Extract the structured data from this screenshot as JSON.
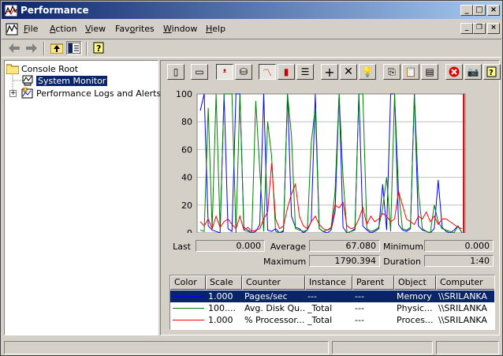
{
  "window": {
    "title": "Performance",
    "controls": [
      "minimize",
      "maximize",
      "close"
    ]
  },
  "menubar": {
    "items": [
      {
        "label": "File",
        "underline": "F"
      },
      {
        "label": "Action",
        "underline": "A"
      },
      {
        "label": "View",
        "underline": "V"
      },
      {
        "label": "Favorites",
        "underline": "o"
      },
      {
        "label": "Window",
        "underline": "W"
      },
      {
        "label": "Help",
        "underline": "H"
      }
    ]
  },
  "toolbar": {
    "icons": [
      "back-arrow-icon",
      "forward-arrow-icon",
      "up-folder-icon",
      "show-tree-icon",
      "help-icon"
    ]
  },
  "tree": {
    "root": "Console Root",
    "items": [
      {
        "label": "System Monitor",
        "selected": true
      },
      {
        "label": "Performance Logs and Alerts",
        "selected": false
      }
    ]
  },
  "sysmon_toolbar": {
    "icons": [
      "new-counter-set-icon",
      "clear-display-icon",
      "view-current-activity-icon",
      "view-log-data-icon",
      "view-graph-icon",
      "view-histogram-icon",
      "view-report-icon",
      "add-counter-icon",
      "delete-counter-icon",
      "highlight-icon",
      "copy-properties-icon",
      "paste-counter-list-icon",
      "properties-icon",
      "freeze-display-icon",
      "update-data-icon",
      "help-icon"
    ]
  },
  "stats": {
    "last_label": "Last",
    "last_value": "0.000",
    "average_label": "Average",
    "average_value": "67.080",
    "minimum_label": "Minimum",
    "minimum_value": "0.000",
    "maximum_label": "Maximum",
    "maximum_value": "1790.394",
    "duration_label": "Duration",
    "duration_value": "1:40"
  },
  "legend": {
    "columns": [
      "Color",
      "Scale",
      "Counter",
      "Instance",
      "Parent",
      "Object",
      "Computer"
    ],
    "rows": [
      {
        "color": "#0000ff",
        "scale": "1.000",
        "counter": "Pages/sec",
        "instance": "---",
        "parent": "---",
        "object": "Memory",
        "computer": "\\\\SRILANKA",
        "selected": true
      },
      {
        "color": "#008000",
        "scale": "100....",
        "counter": "Avg. Disk Qu...",
        "instance": "_Total",
        "parent": "---",
        "object": "Physic...",
        "computer": "\\\\SRILANKA",
        "selected": false
      },
      {
        "color": "#ff0000",
        "scale": "1.000",
        "counter": "% Processor...",
        "instance": "_Total",
        "parent": "---",
        "object": "Proces...",
        "computer": "\\\\SRILANKA",
        "selected": false
      }
    ]
  },
  "chart_data": {
    "type": "line",
    "ylim": [
      0,
      100
    ],
    "y_ticks": [
      "100",
      "80",
      "60",
      "40",
      "20",
      "0"
    ],
    "grid": true,
    "current_time_marker_color": "#ff0000",
    "series": [
      {
        "name": "Pages/sec",
        "color": "#0000ff",
        "values": [
          88,
          100,
          5,
          2,
          1,
          0,
          100,
          3,
          1,
          100,
          100,
          4,
          2,
          0,
          1,
          6,
          100,
          2,
          1,
          3,
          0,
          1,
          100,
          12,
          4,
          3,
          0,
          2,
          8,
          100,
          3,
          1,
          0,
          2,
          15,
          100,
          4,
          0,
          1,
          3,
          100,
          5,
          2,
          0,
          1,
          3,
          35,
          2,
          100,
          100,
          6,
          2,
          1,
          3,
          100,
          5,
          2,
          1,
          0,
          3,
          38,
          4,
          1,
          0,
          2,
          5,
          0
        ]
      },
      {
        "name": "Avg. Disk Qu...",
        "color": "#008000",
        "values": [
          2,
          1,
          90,
          3,
          100,
          2,
          100,
          100,
          100,
          0,
          100,
          2,
          1,
          0,
          95,
          45,
          1,
          80,
          55,
          1,
          0,
          2,
          100,
          70,
          3,
          2,
          1,
          2,
          65,
          90,
          3,
          1,
          2,
          3,
          30,
          100,
          40,
          0,
          1,
          2,
          100,
          100,
          3,
          1,
          2,
          4,
          18,
          40,
          1,
          100,
          30,
          3,
          2,
          4,
          100,
          30,
          3,
          1,
          0,
          20,
          8,
          3,
          2,
          1,
          0,
          5,
          0
        ]
      },
      {
        "name": "% Processor...",
        "color": "#ff0000",
        "values": [
          8,
          5,
          10,
          3,
          12,
          4,
          8,
          10,
          6,
          3,
          12,
          2,
          4,
          1,
          2,
          3,
          10,
          15,
          50,
          10,
          3,
          5,
          18,
          28,
          35,
          12,
          5,
          3,
          8,
          12,
          6,
          3,
          2,
          4,
          20,
          18,
          22,
          5,
          3,
          4,
          10,
          18,
          6,
          12,
          8,
          10,
          14,
          12,
          8,
          10,
          30,
          20,
          10,
          8,
          6,
          12,
          10,
          15,
          8,
          12,
          6,
          10,
          10,
          8,
          6,
          4,
          3
        ]
      }
    ]
  }
}
